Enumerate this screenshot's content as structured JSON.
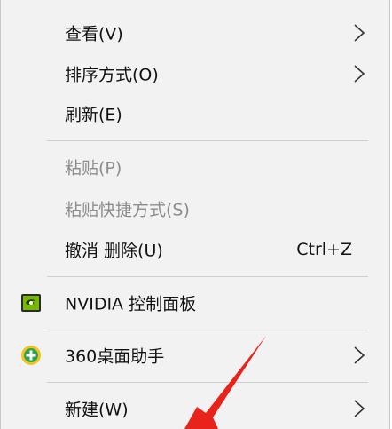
{
  "menu": {
    "items": [
      {
        "label": "查看(V)",
        "submenu": true
      },
      {
        "label": "排序方式(O)",
        "submenu": true
      },
      {
        "label": "刷新(E)"
      },
      {
        "label": "粘贴(P)",
        "disabled": true
      },
      {
        "label": "粘贴快捷方式(S)",
        "disabled": true
      },
      {
        "label": "撤消 删除(U)",
        "shortcut": "Ctrl+Z"
      },
      {
        "label": "NVIDIA 控制面板",
        "icon": "nvidia-icon"
      },
      {
        "label": "360桌面助手",
        "icon": "360-icon",
        "submenu": true
      },
      {
        "label": "新建(W)",
        "submenu": true
      }
    ]
  },
  "colors": {
    "menu_bg": "#f2f2f2",
    "text": "#111111",
    "disabled_text": "#8c8c8c",
    "separator": "#cfcfcf",
    "annotation_arrow": "#e8231b",
    "nvidia_green": "#76b900",
    "icon_360_yellow": "#f4c21c"
  }
}
